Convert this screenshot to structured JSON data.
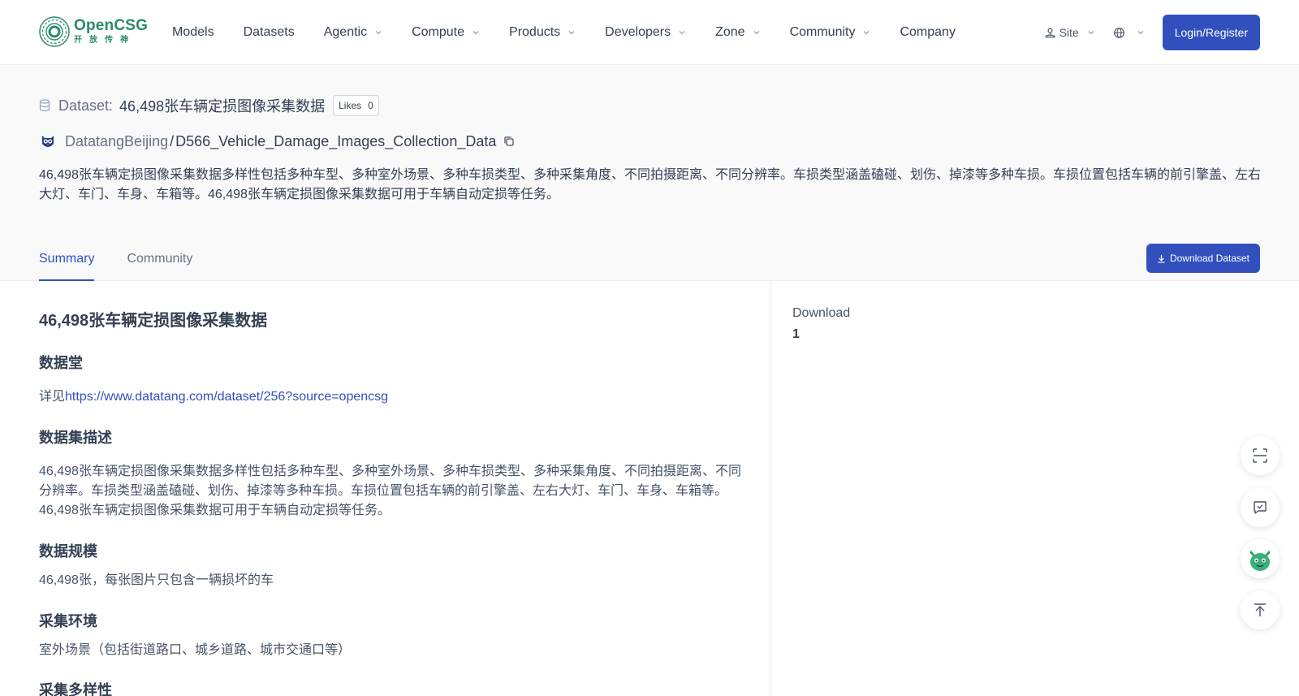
{
  "header": {
    "logo": {
      "name": "OpenCSG",
      "sub": "开放传神"
    },
    "nav": [
      {
        "label": "Models",
        "dropdown": false
      },
      {
        "label": "Datasets",
        "dropdown": false
      },
      {
        "label": "Agentic",
        "dropdown": true
      },
      {
        "label": "Compute",
        "dropdown": true
      },
      {
        "label": "Products",
        "dropdown": true
      },
      {
        "label": "Developers",
        "dropdown": true
      },
      {
        "label": "Zone",
        "dropdown": true
      },
      {
        "label": "Community",
        "dropdown": true
      },
      {
        "label": "Company",
        "dropdown": false
      }
    ],
    "site_label": "Site",
    "login_label": "Login/Register"
  },
  "dataset": {
    "label": "Dataset:",
    "name": "46,498张车辆定损图像采集数据",
    "likes_label": "Likes",
    "likes_count": "0",
    "owner": "DatatangBeijing",
    "separator": "/",
    "repo": "D566_Vehicle_Damage_Images_Collection_Data",
    "description": "46,498张车辆定损图像采集数据多样性包括多种车型、多种室外场景、多种车损类型、多种采集角度、不同拍摄距离、不同分辨率。车损类型涵盖磕碰、划伤、掉漆等多种车损。车损位置包括车辆的前引擎盖、左右大灯、车门、车身、车箱等。46,498张车辆定损图像采集数据可用于车辆自动定损等任务。"
  },
  "tabs": [
    {
      "label": "Summary",
      "active": true
    },
    {
      "label": "Community",
      "active": false
    }
  ],
  "download_button_label": "Download Dataset",
  "readme": {
    "title": "46,498张车辆定损图像采集数据",
    "sections": [
      {
        "heading": "数据堂",
        "prefix": "详见",
        "link": "https://www.datatang.com/dataset/256?source=opencsg"
      },
      {
        "heading": "数据集描述",
        "text": "46,498张车辆定损图像采集数据多样性包括多种车型、多种室外场景、多种车损类型、多种采集角度、不同拍摄距离、不同分辨率。车损类型涵盖磕碰、划伤、掉漆等多种车损。车损位置包括车辆的前引擎盖、左右大灯、车门、车身、车箱等。46,498张车辆定损图像采集数据可用于车辆自动定损等任务。"
      },
      {
        "heading": "数据规模",
        "text": "46,498张，每张图片只包含一辆损坏的车"
      },
      {
        "heading": "采集环境",
        "text": "室外场景（包括街道路口、城乡道路、城市交通口等）"
      },
      {
        "heading": "采集多样性"
      }
    ]
  },
  "sidebar": {
    "download_label": "Download",
    "download_count": "1"
  },
  "colors": {
    "brand": "#3250bd",
    "logo_green": "#2b8a6e",
    "hero_bg": "#f9f9fa"
  }
}
